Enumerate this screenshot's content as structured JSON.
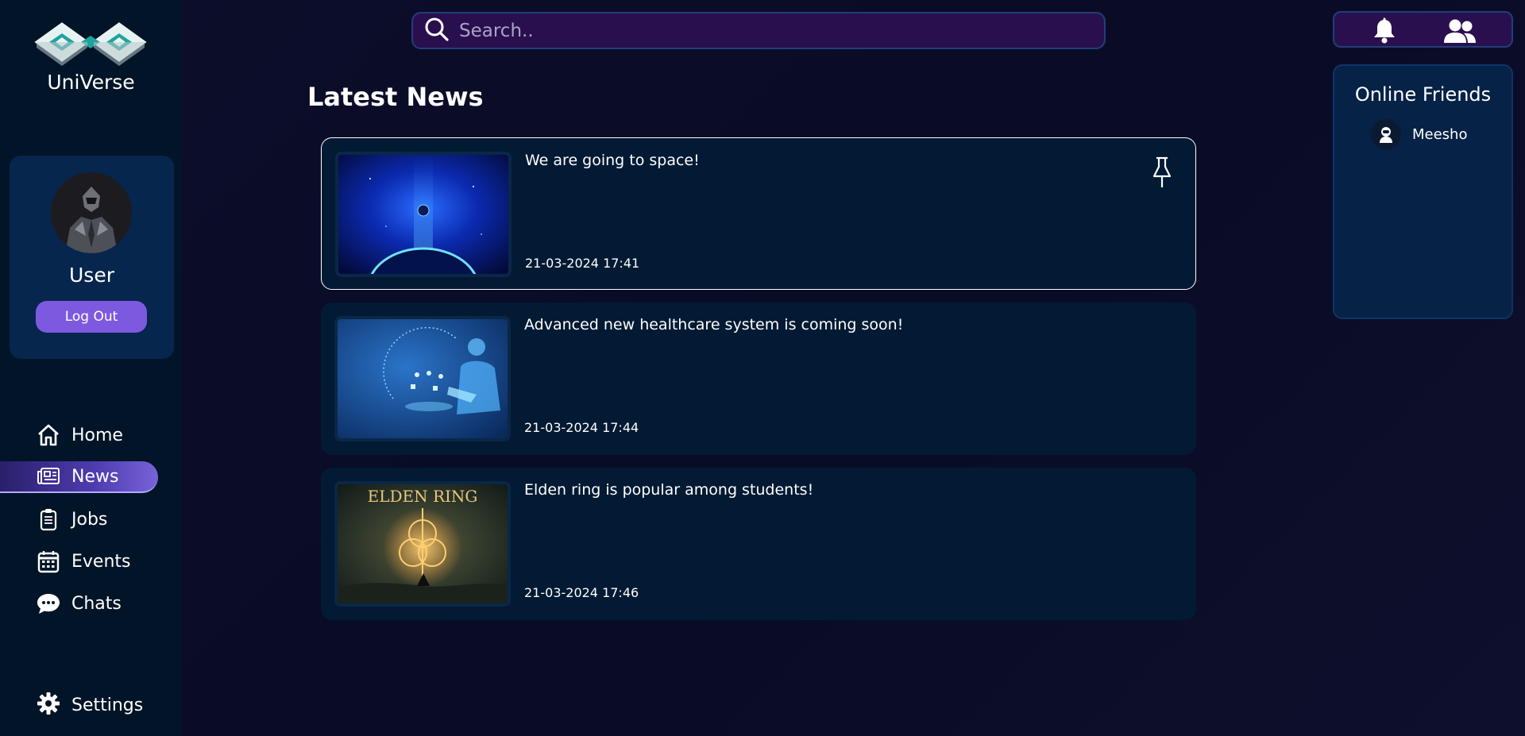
{
  "app": {
    "name": "UniVerse"
  },
  "profile": {
    "name": "User",
    "logout_label": "Log Out"
  },
  "nav": [
    {
      "label": "Home",
      "icon": "home-icon"
    },
    {
      "label": "News",
      "icon": "newspaper-icon",
      "active": true
    },
    {
      "label": "Jobs",
      "icon": "clipboard-icon"
    },
    {
      "label": "Events",
      "icon": "calendar-icon"
    },
    {
      "label": "Chats",
      "icon": "chat-bubble-icon"
    }
  ],
  "settings": {
    "label": "Settings",
    "icon": "gear-icon"
  },
  "search": {
    "placeholder": "Search..",
    "value": ""
  },
  "header_icons": [
    "bell-icon",
    "friends-icon"
  ],
  "main": {
    "title": "Latest News"
  },
  "news": [
    {
      "title": "We are going to space!",
      "date": "21-03-2024 17:41",
      "selected": true,
      "pinned_icon": "pin-icon"
    },
    {
      "title": "Advanced new healthcare system is coming soon!",
      "date": "21-03-2024 17:44"
    },
    {
      "title": "Elden ring is popular among students!",
      "date": "21-03-2024 17:46",
      "image_text": "ELDEN RING"
    }
  ],
  "friends": {
    "title": "Online Friends",
    "list": [
      {
        "name": "Meesho"
      }
    ]
  },
  "colors": {
    "sidebar_bg": "#021528",
    "card_bg": "#021a33",
    "accent": "#7d59e0",
    "search_bg": "#2a0f4f"
  }
}
